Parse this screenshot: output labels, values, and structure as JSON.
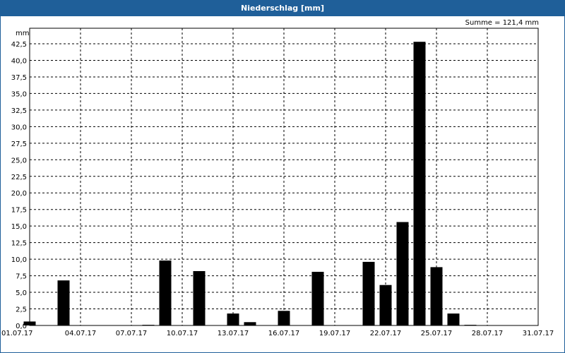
{
  "window": {
    "title": "Niederschlag [mm]"
  },
  "summary": {
    "text": "Summe = 121,4 mm"
  },
  "colors": {
    "titlebar": "#1f5f99",
    "bar": "#000000",
    "grid": "#000000"
  },
  "chart_data": {
    "type": "bar",
    "title": "Niederschlag [mm]",
    "ylabel": "mm",
    "xlabel": "",
    "ylim": [
      0,
      45
    ],
    "grid": true,
    "annotation": "Summe = 121,4 mm",
    "y_ticks": [
      "0,0",
      "2,5",
      "5,0",
      "7,5",
      "10,0",
      "12,5",
      "15,0",
      "17,5",
      "20,0",
      "22,5",
      "25,0",
      "27,5",
      "30,0",
      "32,5",
      "35,0",
      "37,5",
      "40,0",
      "42,5"
    ],
    "x_ticks": [
      "01.07.17",
      "04.07.17",
      "07.07.17",
      "10.07.17",
      "13.07.17",
      "16.07.17",
      "19.07.17",
      "22.07.17",
      "25.07.17",
      "28.07.17",
      "31.07.17"
    ],
    "categories": [
      "01.07.17",
      "02.07.17",
      "03.07.17",
      "04.07.17",
      "05.07.17",
      "06.07.17",
      "07.07.17",
      "08.07.17",
      "09.07.17",
      "10.07.17",
      "11.07.17",
      "12.07.17",
      "13.07.17",
      "14.07.17",
      "15.07.17",
      "16.07.17",
      "17.07.17",
      "18.07.17",
      "19.07.17",
      "20.07.17",
      "21.07.17",
      "22.07.17",
      "23.07.17",
      "24.07.17",
      "25.07.17",
      "26.07.17",
      "27.07.17",
      "28.07.17",
      "29.07.17",
      "30.07.17",
      "31.07.17"
    ],
    "values": [
      0.6,
      0,
      6.8,
      0,
      0,
      0,
      0,
      0.1,
      9.8,
      0,
      8.2,
      0,
      1.8,
      0.5,
      0,
      2.2,
      0,
      8.1,
      0,
      0,
      9.6,
      6.1,
      15.6,
      42.8,
      8.8,
      1.8,
      0.1,
      0,
      0,
      0,
      0
    ]
  }
}
